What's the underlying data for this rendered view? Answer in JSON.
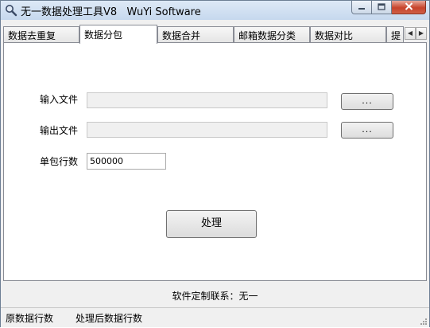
{
  "window": {
    "title": "无一数据处理工具V8   WuYi Software",
    "icon": "magnifier-icon",
    "controls": {
      "minimize": "minimize-icon",
      "maximize": "maximize-icon",
      "close": "close-icon"
    }
  },
  "tabs": [
    {
      "label": "数据去重复",
      "active": false
    },
    {
      "label": "数据分包",
      "active": true
    },
    {
      "label": "数据合并",
      "active": false
    },
    {
      "label": "邮箱数据分类",
      "active": false
    },
    {
      "label": "数据对比",
      "active": false
    },
    {
      "label": "提",
      "active": false
    }
  ],
  "tab_scroll": {
    "left": "◀",
    "right": "▶"
  },
  "form": {
    "input_file_label": "输入文件",
    "input_file_value": "",
    "output_file_label": "输出文件",
    "output_file_value": "",
    "browse_label": "...",
    "rows_per_pack_label": "单包行数",
    "rows_per_pack_value": "500000",
    "process_label": "处理"
  },
  "footer": {
    "contact": "软件定制联系：无一"
  },
  "statusbar": {
    "original_rows": "原数据行数",
    "processed_rows": "处理后数据行数"
  }
}
